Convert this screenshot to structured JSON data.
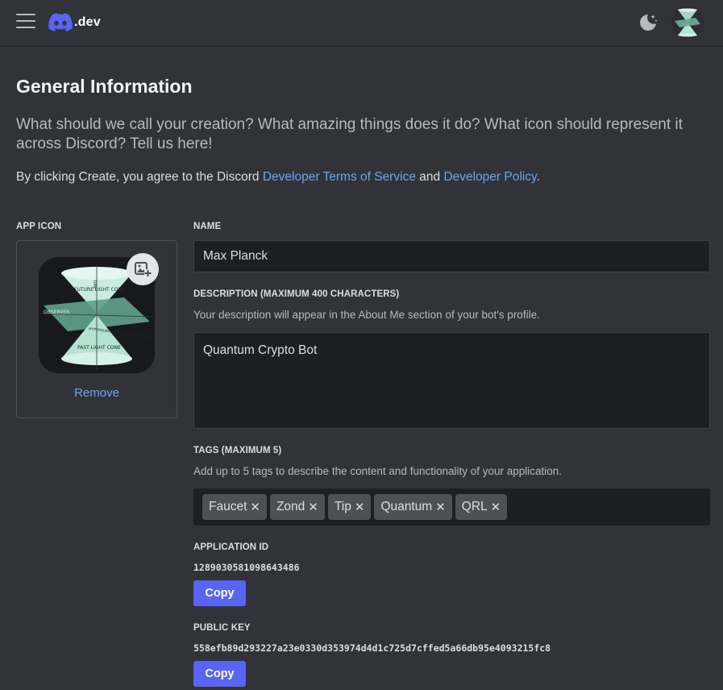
{
  "header": {
    "logo_text": ".dev",
    "icons": {
      "menu": "hamburger-menu-icon",
      "logo": "discord-logo-icon",
      "theme": "moon-stars-icon",
      "avatar": "user-avatar"
    }
  },
  "page": {
    "title": "General Information",
    "intro": "What should we call your creation? What amazing things does it do? What icon should represent it across Discord? Tell us here!",
    "agreement_prefix": "By clicking Create, you agree to the Discord ",
    "terms_link": "Developer Terms of Service",
    "agreement_and": " and ",
    "policy_link": "Developer Policy",
    "agreement_suffix": "."
  },
  "app_icon": {
    "label": "App Icon",
    "remove_label": "Remove",
    "image_labels": {
      "top": "FUTURE LIGHT CONE",
      "time": "TIME",
      "observer": "OBSERVER",
      "hypersurface": "HYPERSURFACE OF THE PRESENT",
      "bottom": "PAST LIGHT CONE"
    }
  },
  "name": {
    "label": "Name",
    "value": "Max Planck"
  },
  "description": {
    "label": "Description (maximum 400 characters)",
    "hint": "Your description will appear in the About Me section of your bot's profile.",
    "value": "Quantum Crypto Bot"
  },
  "tags": {
    "label": "Tags (maximum 5)",
    "hint": "Add up to 5 tags to describe the content and functionality of your application.",
    "items": [
      "Faucet",
      "Zond",
      "Tip",
      "Quantum",
      "QRL"
    ]
  },
  "application_id": {
    "label": "Application ID",
    "value": "1289030581098643486",
    "copy_label": "Copy"
  },
  "public_key": {
    "label": "Public Key",
    "value": "558efb89d293227a23e0330d353974d4d1c725d7cffed5a66db95e4093215fc8",
    "copy_label": "Copy"
  },
  "colors": {
    "background": "#313338",
    "input_bg": "#1e1f22",
    "link": "#6ba5ef",
    "primary_button": "#5865f2",
    "tag_bg": "#4e5058"
  }
}
